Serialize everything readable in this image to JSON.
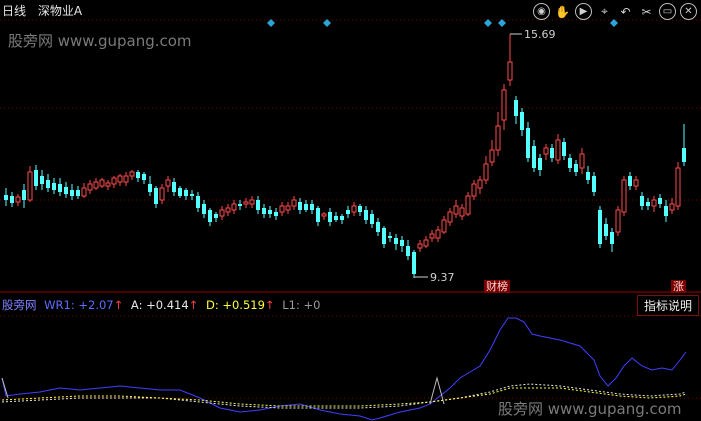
{
  "header": {
    "period": "日线",
    "stock_name": "深物业A"
  },
  "watermark": {
    "text": "股旁网 www.gupang.com"
  },
  "toolbar": [
    {
      "name": "eye-icon",
      "glyph": "◉"
    },
    {
      "name": "hand-icon",
      "glyph": "✋"
    },
    {
      "name": "play-icon",
      "glyph": "▶"
    },
    {
      "name": "crosshair-icon",
      "glyph": "⌖"
    },
    {
      "name": "undo-icon",
      "glyph": "↶"
    },
    {
      "name": "scissors-icon",
      "glyph": "✂"
    },
    {
      "name": "restore-icon",
      "glyph": "▭"
    },
    {
      "name": "close-icon",
      "glyph": "✕"
    }
  ],
  "price": {
    "high_label": "15.69",
    "low_label": "9.37",
    "tag_left": "财榜",
    "tag_right": "涨"
  },
  "indicator": {
    "source": "股旁网",
    "wr1": "WR1: +2.07",
    "a": "A: +0.414",
    "d": "D: +0.519",
    "l1": "L1: +0",
    "button": "指标说明"
  },
  "colors": {
    "up": "#ff4a4a",
    "down": "#54ffff",
    "diamond": "#2aa5d8",
    "grid": "#7a0000",
    "wr_line": "#4040ff",
    "a_line": "#e8e8e8",
    "d_line": "#ffff40"
  }
}
